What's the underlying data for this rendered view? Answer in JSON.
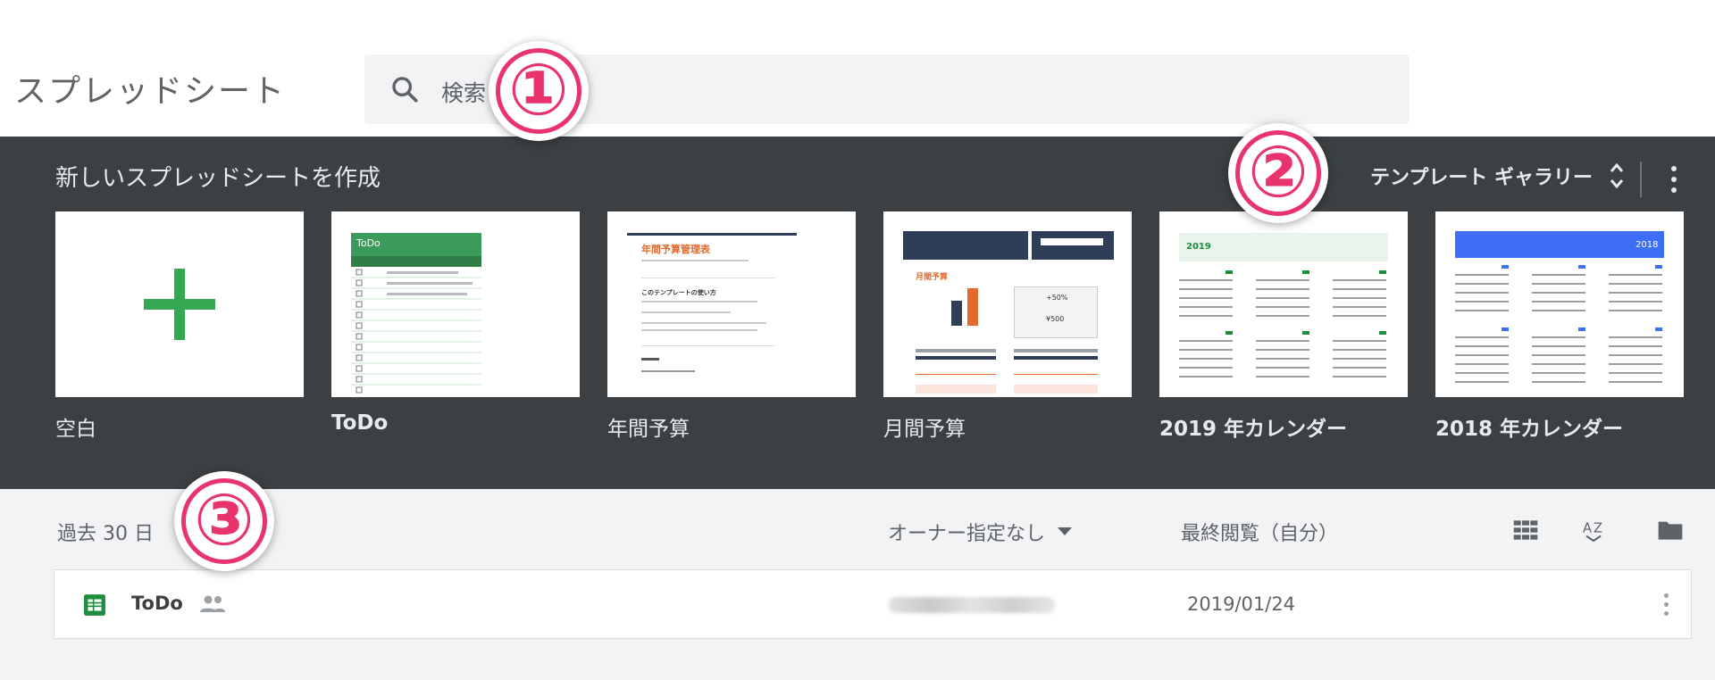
{
  "header": {
    "app_title": "スプレッドシート",
    "search_placeholder": "検索"
  },
  "gallery": {
    "title": "新しいスプレッドシートを作成",
    "toggle_label": "テンプレート ギャラリー",
    "templates": [
      {
        "label": "空白",
        "thumb_icon": "plus-icon"
      },
      {
        "label": "ToDo",
        "thumb_header": "ToDo"
      },
      {
        "label": "年間予算",
        "thumb_title": "年間予算管理表",
        "thumb_subtitle": "このテンプレートの使い方"
      },
      {
        "label": "月間予算",
        "thumb_title": "月間予算",
        "thumb_values": [
          "+50%",
          "¥500"
        ]
      },
      {
        "label": "2019 年カレンダー",
        "thumb_year": "2019"
      },
      {
        "label": "2018 年カレンダー",
        "thumb_year": "2018"
      }
    ]
  },
  "recent": {
    "title": "過去 30 日",
    "owner_filter": "オーナー指定なし",
    "sort_label": "最終閲覧（自分）",
    "files": [
      {
        "name": "ToDo",
        "date": "2019/01/24"
      }
    ]
  },
  "callouts": [
    "①",
    "②",
    "③"
  ],
  "colors": {
    "gallery_bg": "#3c4043",
    "sheets_green": "#1e8e3e",
    "callout_pink": "#e8336d",
    "calendar_2018_blue": "#3d6ef5"
  }
}
